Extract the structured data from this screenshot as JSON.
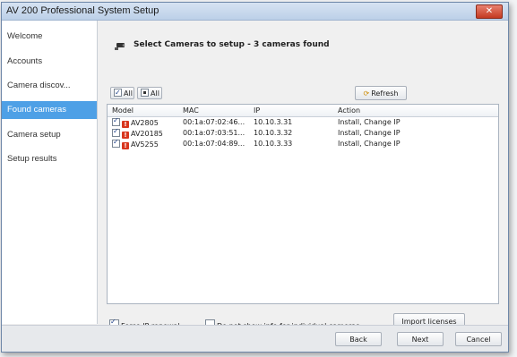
{
  "window": {
    "title": "AV 200 Professional System Setup",
    "close_label": "✕"
  },
  "sidebar": {
    "items": [
      {
        "label": "Welcome"
      },
      {
        "label": "Accounts"
      },
      {
        "label": "Camera discov..."
      },
      {
        "label": "Found cameras"
      },
      {
        "label": "Camera setup"
      },
      {
        "label": "Setup results"
      }
    ],
    "active_index": 3
  },
  "main": {
    "heading": "Select Cameras to setup - 3 cameras found",
    "select_all_1": "All",
    "select_all_2": "All",
    "refresh_label": "Refresh",
    "table": {
      "columns": [
        "Model",
        "MAC",
        "IP",
        "Action"
      ],
      "rows": [
        {
          "model": "AV2805",
          "mac": "00:1a:07:02:46...",
          "ip": "10.10.3.31",
          "action": "Install, Change IP"
        },
        {
          "model": "AV20185",
          "mac": "00:1a:07:03:51...",
          "ip": "10.10.3.32",
          "action": "Install, Change IP"
        },
        {
          "model": "AV5255",
          "mac": "00:1a:07:04:89...",
          "ip": "10.10.3.33",
          "action": "Install, Change IP"
        }
      ]
    },
    "force_ip_renewal": "Force IP renewal",
    "do_not_show": "Do not show info for individual cameras.",
    "import_licenses": "Import licenses"
  },
  "footer": {
    "back": "Back",
    "next": "Next",
    "cancel": "Cancel"
  },
  "colors": {
    "active_nav": "#4ea0e6",
    "warning": "#d8361e",
    "close": "#c43a22"
  },
  "icons": {
    "heading": "camera-icon",
    "refresh": "refresh-icon",
    "warning": "warning-icon"
  }
}
